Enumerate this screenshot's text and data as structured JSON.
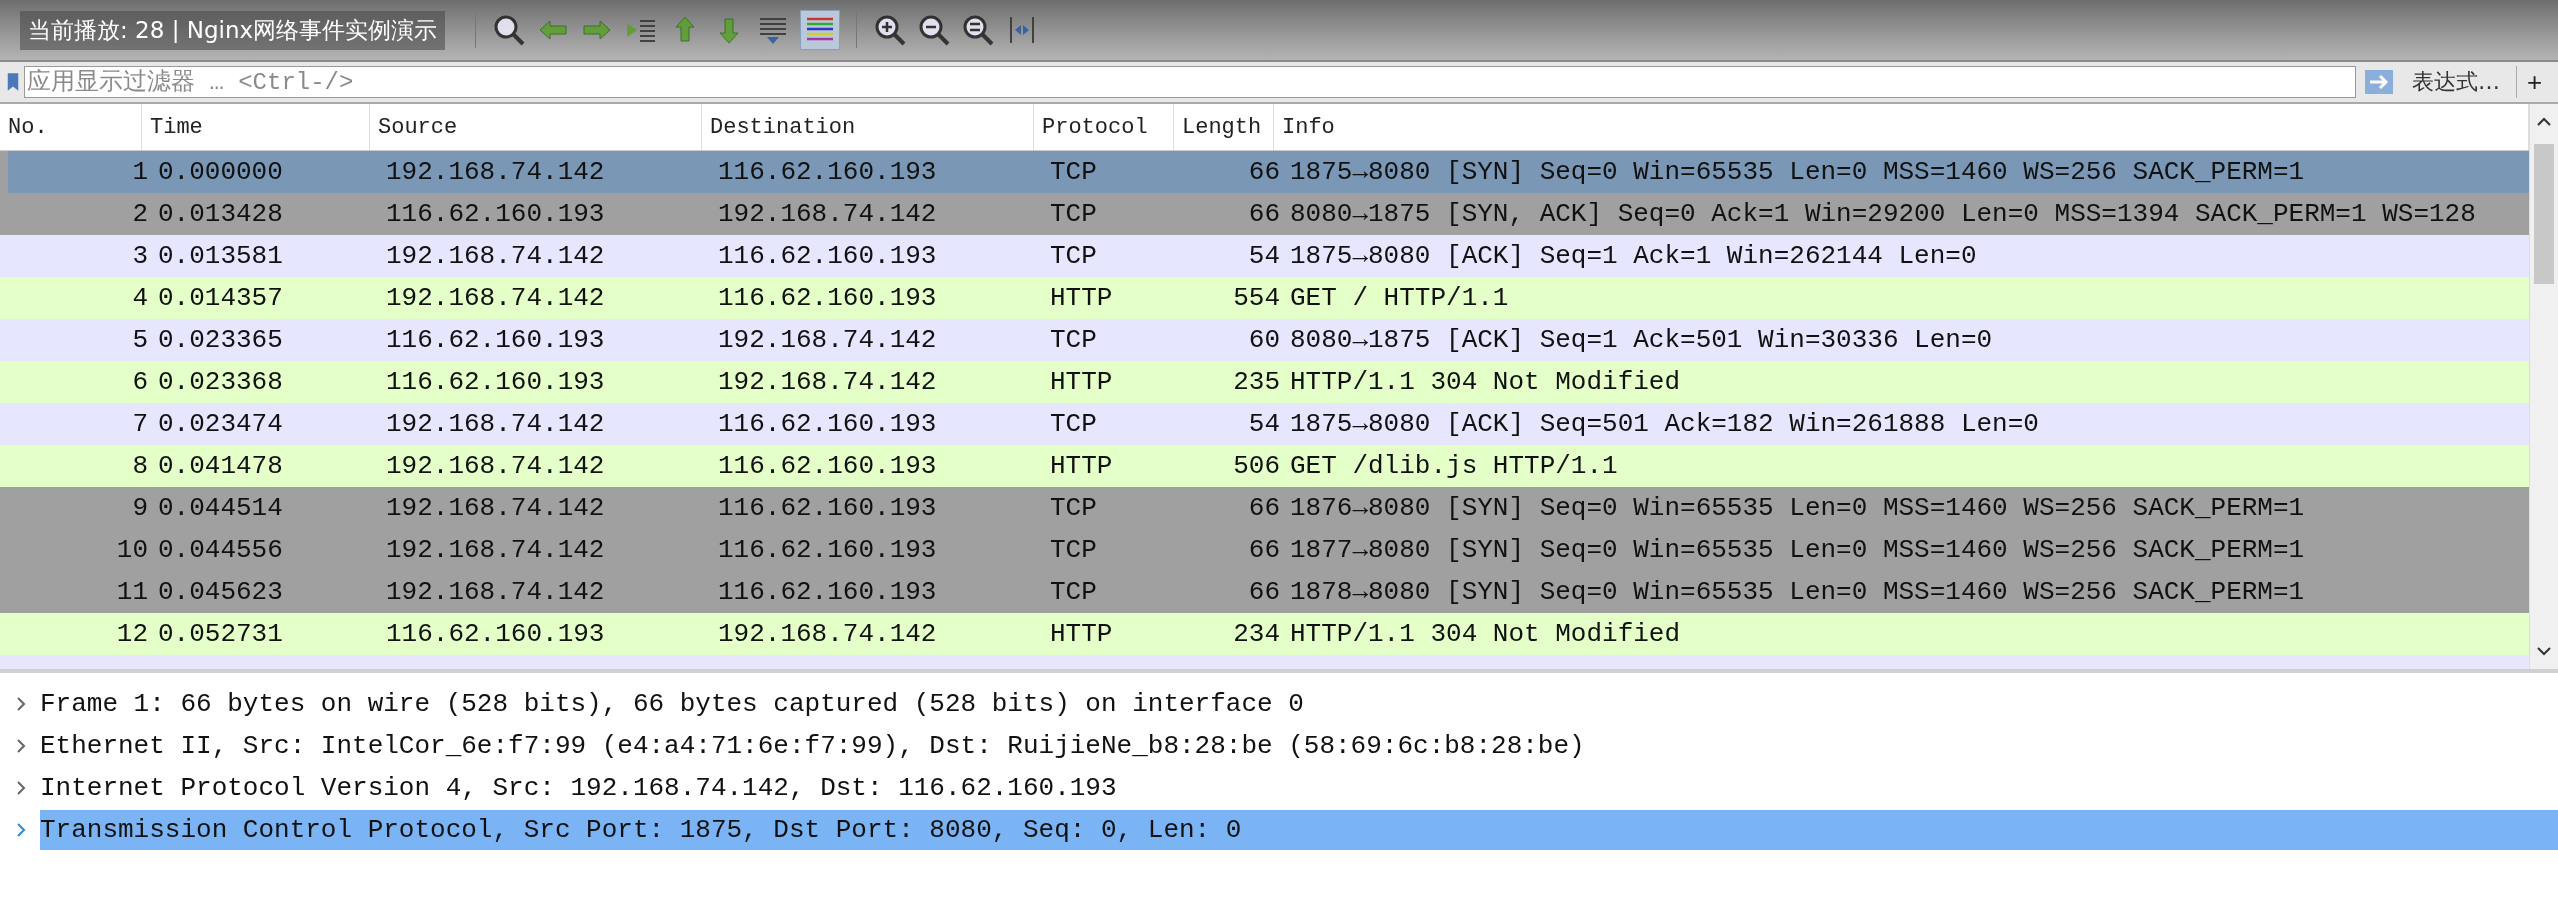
{
  "overlay": {
    "now_playing": "当前播放: 28 | Nginx网络事件实例演示"
  },
  "filter_bar": {
    "placeholder": "应用显示过滤器 … <Ctrl-/>",
    "expression_button": "表达式…",
    "add_button": "+"
  },
  "packet_list": {
    "columns": [
      "No.",
      "Time",
      "Source",
      "Destination",
      "Protocol",
      "Length",
      "Info"
    ],
    "rows": [
      {
        "no": "1",
        "time": "0.000000",
        "source": "192.168.74.142",
        "destination": "116.62.160.193",
        "protocol": "TCP",
        "length": "66",
        "info": "1875→8080 [SYN] Seq=0 Win=65535 Len=0 MSS=1460 WS=256 SACK_PERM=1",
        "color": "#a0a0a0",
        "selected": true
      },
      {
        "no": "2",
        "time": "0.013428",
        "source": "116.62.160.193",
        "destination": "192.168.74.142",
        "protocol": "TCP",
        "length": "66",
        "info": "8080→1875 [SYN, ACK] Seq=0 Ack=1 Win=29200 Len=0 MSS=1394 SACK_PERM=1 WS=128",
        "color": "#a0a0a0",
        "selected": false
      },
      {
        "no": "3",
        "time": "0.013581",
        "source": "192.168.74.142",
        "destination": "116.62.160.193",
        "protocol": "TCP",
        "length": "54",
        "info": "1875→8080 [ACK] Seq=1 Ack=1 Win=262144 Len=0",
        "color": "#e7e6ff",
        "selected": false
      },
      {
        "no": "4",
        "time": "0.014357",
        "source": "192.168.74.142",
        "destination": "116.62.160.193",
        "protocol": "HTTP",
        "length": "554",
        "info": "GET / HTTP/1.1",
        "color": "#e4ffc7",
        "selected": false
      },
      {
        "no": "5",
        "time": "0.023365",
        "source": "116.62.160.193",
        "destination": "192.168.74.142",
        "protocol": "TCP",
        "length": "60",
        "info": "8080→1875 [ACK] Seq=1 Ack=501 Win=30336 Len=0",
        "color": "#e7e6ff",
        "selected": false
      },
      {
        "no": "6",
        "time": "0.023368",
        "source": "116.62.160.193",
        "destination": "192.168.74.142",
        "protocol": "HTTP",
        "length": "235",
        "info": "HTTP/1.1 304 Not Modified",
        "color": "#e4ffc7",
        "selected": false
      },
      {
        "no": "7",
        "time": "0.023474",
        "source": "192.168.74.142",
        "destination": "116.62.160.193",
        "protocol": "TCP",
        "length": "54",
        "info": "1875→8080 [ACK] Seq=501 Ack=182 Win=261888 Len=0",
        "color": "#e7e6ff",
        "selected": false
      },
      {
        "no": "8",
        "time": "0.041478",
        "source": "192.168.74.142",
        "destination": "116.62.160.193",
        "protocol": "HTTP",
        "length": "506",
        "info": "GET /dlib.js HTTP/1.1",
        "color": "#e4ffc7",
        "selected": false
      },
      {
        "no": "9",
        "time": "0.044514",
        "source": "192.168.74.142",
        "destination": "116.62.160.193",
        "protocol": "TCP",
        "length": "66",
        "info": "1876→8080 [SYN] Seq=0 Win=65535 Len=0 MSS=1460 WS=256 SACK_PERM=1",
        "color": "#a0a0a0",
        "selected": false
      },
      {
        "no": "10",
        "time": "0.044556",
        "source": "192.168.74.142",
        "destination": "116.62.160.193",
        "protocol": "TCP",
        "length": "66",
        "info": "1877→8080 [SYN] Seq=0 Win=65535 Len=0 MSS=1460 WS=256 SACK_PERM=1",
        "color": "#a0a0a0",
        "selected": false
      },
      {
        "no": "11",
        "time": "0.045623",
        "source": "192.168.74.142",
        "destination": "116.62.160.193",
        "protocol": "TCP",
        "length": "66",
        "info": "1878→8080 [SYN] Seq=0 Win=65535 Len=0 MSS=1460 WS=256 SACK_PERM=1",
        "color": "#a0a0a0",
        "selected": false
      },
      {
        "no": "12",
        "time": "0.052731",
        "source": "116.62.160.193",
        "destination": "192.168.74.142",
        "protocol": "HTTP",
        "length": "234",
        "info": "HTTP/1.1 304 Not Modified",
        "color": "#e4ffc7",
        "selected": false
      }
    ]
  },
  "details": [
    {
      "text": "Frame 1: 66 bytes on wire (528 bits), 66 bytes captured (528 bits) on interface 0",
      "expanded": false,
      "selected": false
    },
    {
      "text": "Ethernet II, Src: IntelCor_6e:f7:99 (e4:a4:71:6e:f7:99), Dst: RuijieNe_b8:28:be (58:69:6c:b8:28:be)",
      "expanded": false,
      "selected": false
    },
    {
      "text": "Internet Protocol Version 4, Src: 192.168.74.142, Dst: 116.62.160.193",
      "expanded": false,
      "selected": false
    },
    {
      "text": "Transmission Control Protocol, Src Port: 1875, Dst Port: 8080, Seq: 0, Len: 0",
      "expanded": false,
      "selected": true
    }
  ]
}
